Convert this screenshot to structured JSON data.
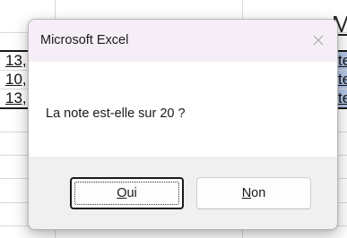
{
  "dialog": {
    "title": "Microsoft Excel",
    "message": "La note est-elle sur 20 ?",
    "buttons": {
      "yes": {
        "accel": "O",
        "rest": "ui"
      },
      "no": {
        "accel": "N",
        "rest": "on"
      }
    }
  },
  "background_sheet": {
    "header_partial": "M",
    "rows_left": [
      "13,",
      "10,",
      "13,"
    ],
    "rows_right": [
      "te",
      "te",
      "te"
    ],
    "accent_blue": "#b4c6e7"
  },
  "colors": {
    "titlebar": "#f6eef7",
    "content": "#ffffff",
    "footer": "#f0f0f0"
  }
}
